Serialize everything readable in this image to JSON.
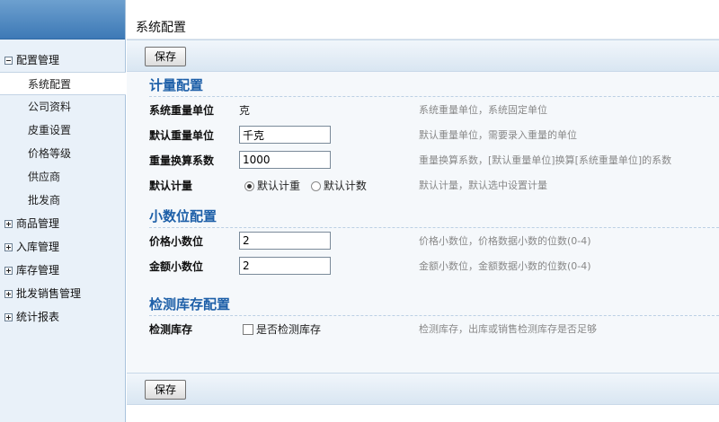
{
  "sidebar": {
    "groups": [
      {
        "label": "配置管理",
        "expanded": true
      },
      {
        "label": "商品管理",
        "expanded": false
      },
      {
        "label": "入库管理",
        "expanded": false
      },
      {
        "label": "库存管理",
        "expanded": false
      },
      {
        "label": "批发销售管理",
        "expanded": false
      },
      {
        "label": "统计报表",
        "expanded": false
      }
    ],
    "config_items": [
      "系统配置",
      "公司资料",
      "皮重设置",
      "价格等级",
      "供应商",
      "批发商"
    ],
    "active_item": "系统配置"
  },
  "page": {
    "title": "系统配置",
    "save_label": "保存"
  },
  "sections": {
    "metering": {
      "title": "计量配置",
      "rows": [
        {
          "label": "系统重量单位",
          "value": "克",
          "hint": "系统重量单位，系统固定单位"
        },
        {
          "label": "默认重量单位",
          "value": "千克",
          "hint": "默认重量单位，需要录入重量的单位"
        },
        {
          "label": "重量换算系数",
          "value": "1000",
          "hint": "重量换算系数，[默认重量单位]换算[系统重量单位]的系数"
        },
        {
          "label": "默认计量",
          "options": [
            "默认计重",
            "默认计数"
          ],
          "selected": "默认计重",
          "hint": "默认计量，默认选中设置计量"
        }
      ]
    },
    "decimal": {
      "title": "小数位配置",
      "rows": [
        {
          "label": "价格小数位",
          "value": "2",
          "hint": "价格小数位，价格数据小数的位数(0-4)"
        },
        {
          "label": "金额小数位",
          "value": "2",
          "hint": "金额小数位，金额数据小数的位数(0-4)"
        }
      ]
    },
    "stock": {
      "title": "检测库存配置",
      "rows": [
        {
          "label": "检测库存",
          "checkbox_label": "是否检测库存",
          "checked": false,
          "hint": "检测库存，出库或销售检测库存是否足够"
        }
      ]
    }
  }
}
